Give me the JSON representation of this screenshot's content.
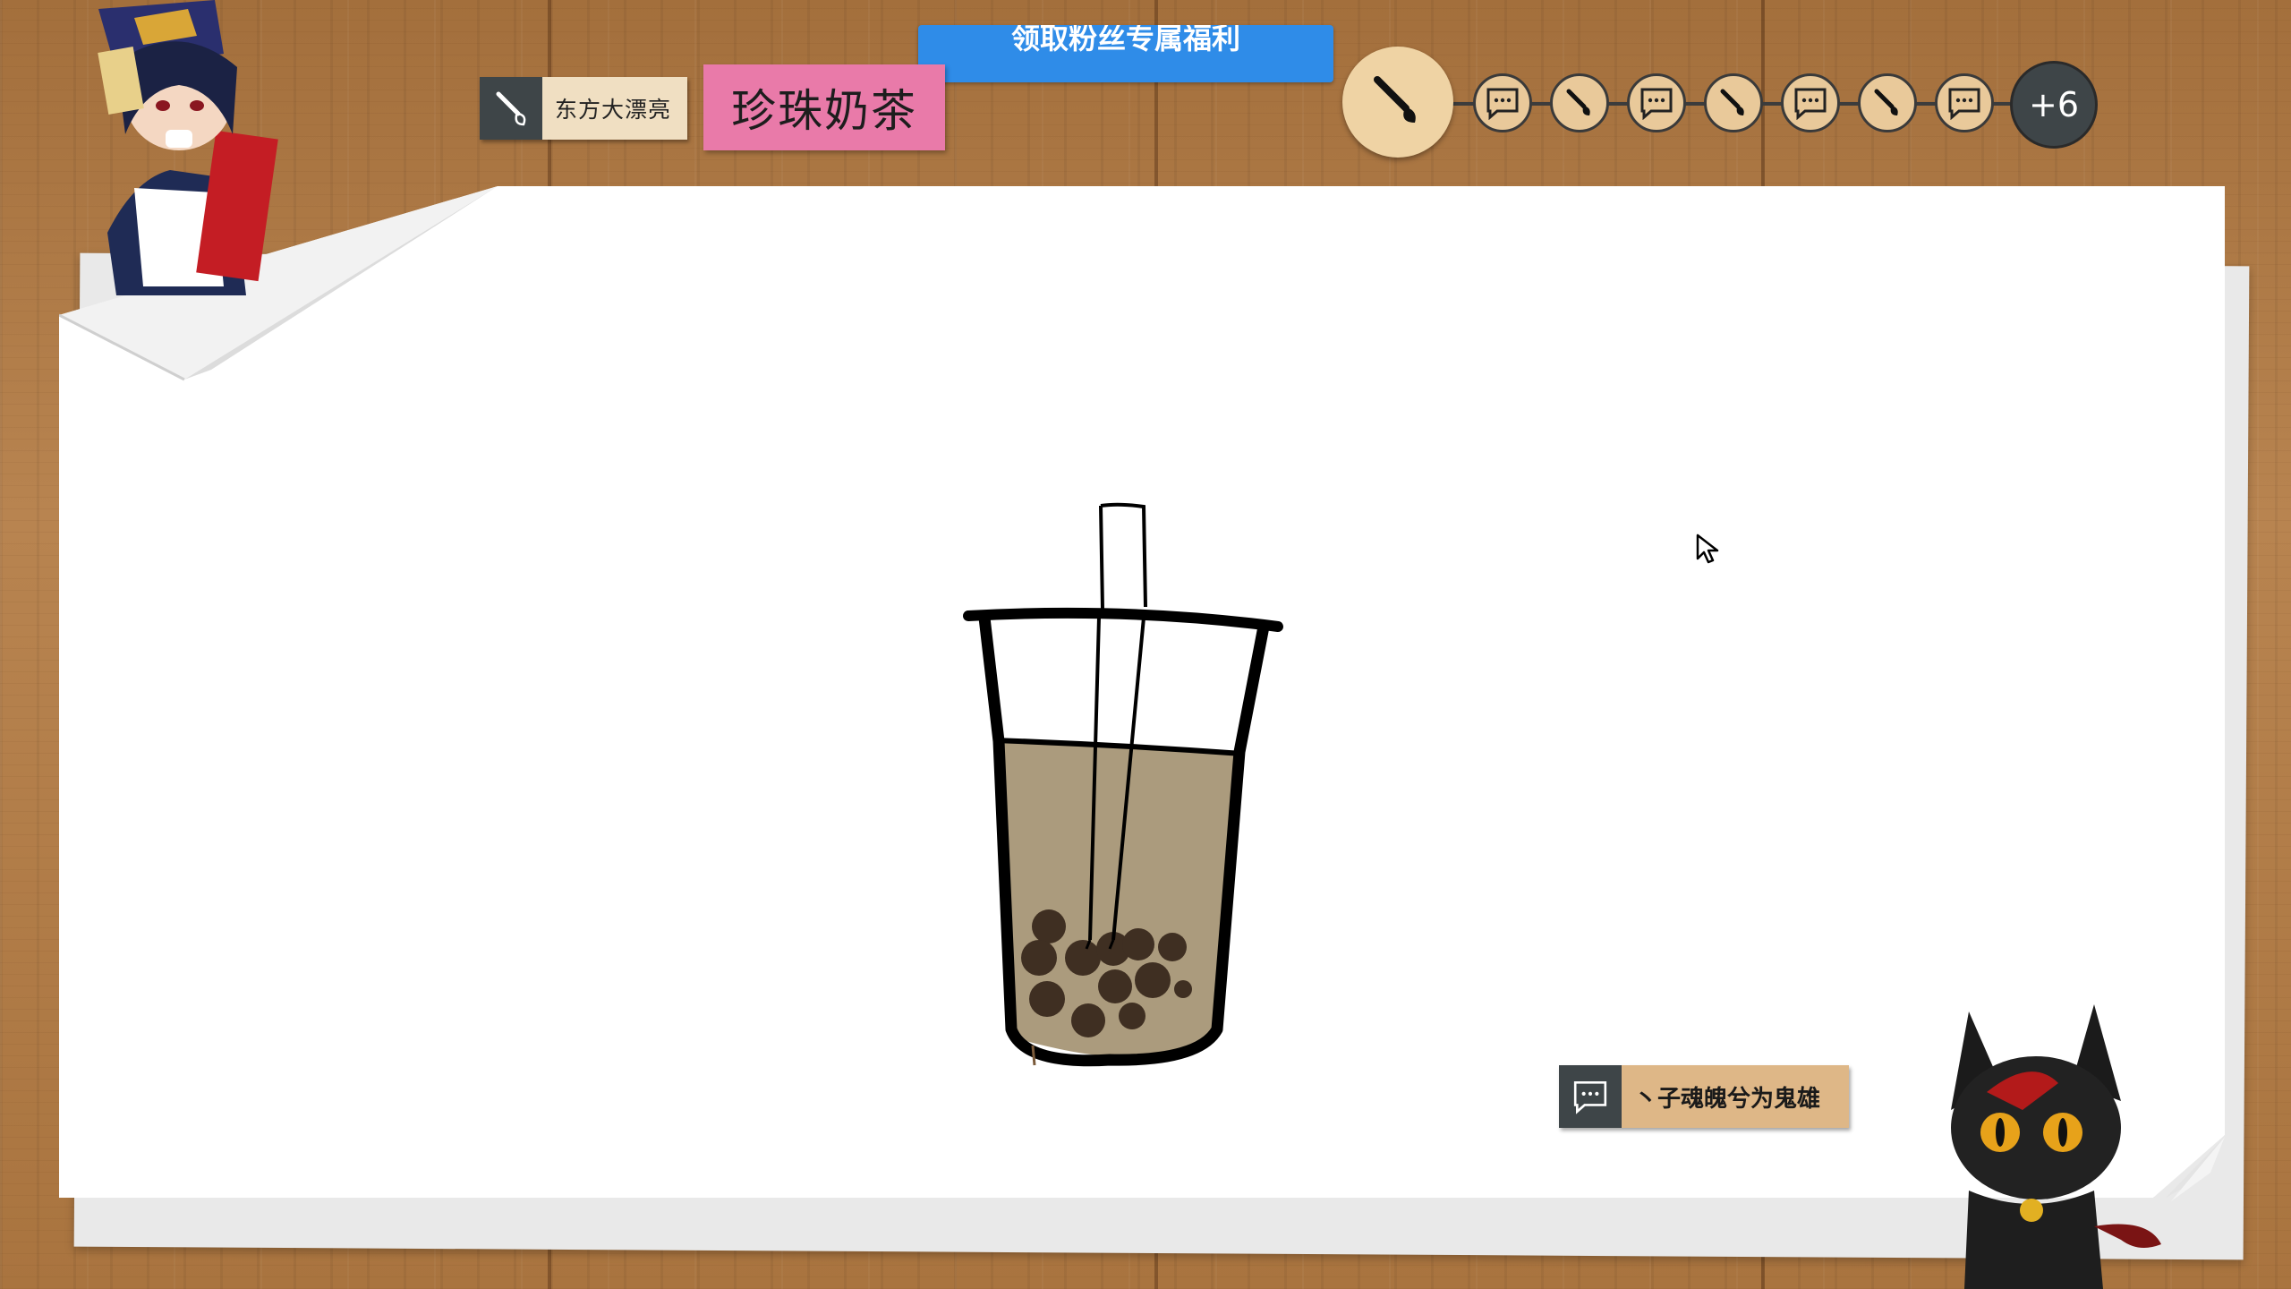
{
  "banner": {
    "text": "领取粉丝专属福利"
  },
  "artist": {
    "name": "东方大漂亮",
    "icon": "brush-icon"
  },
  "word": {
    "text": "珍珠奶茶"
  },
  "turns": {
    "current_icon": "brush-icon",
    "sequence": [
      "chat-icon",
      "brush-icon",
      "chat-icon",
      "brush-icon",
      "chat-icon",
      "brush-icon",
      "chat-icon"
    ],
    "more_label": "+6"
  },
  "chat": {
    "icon": "chat-icon",
    "message": "丶子魂魄兮为鬼雄"
  },
  "colors": {
    "wood": "#b07a44",
    "artist_tag": "#f0dfc2",
    "word_tag": "#e97aa9",
    "banner": "#2f8ce8",
    "turn_token": "#e9c99a",
    "dark_token": "#3e4548",
    "milk_tea": "#ab9b7d",
    "pearl": "#3f2f22"
  }
}
